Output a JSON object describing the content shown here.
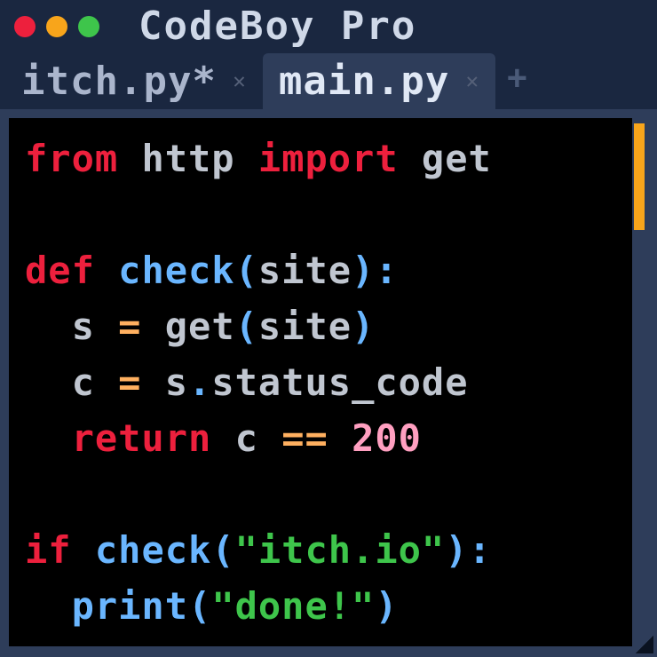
{
  "window": {
    "title": "CodeBoy Pro"
  },
  "tabs": [
    {
      "label": "itch.py*",
      "active": false
    },
    {
      "label": "main.py",
      "active": true
    }
  ],
  "code": {
    "lines": [
      [
        {
          "cls": "tok-kw",
          "t": "from"
        },
        {
          "cls": "",
          "t": " "
        },
        {
          "cls": "tok-id",
          "t": "http"
        },
        {
          "cls": "",
          "t": " "
        },
        {
          "cls": "tok-kw",
          "t": "import"
        },
        {
          "cls": "",
          "t": " "
        },
        {
          "cls": "tok-id",
          "t": "get"
        }
      ],
      [],
      [
        {
          "cls": "tok-kw",
          "t": "def"
        },
        {
          "cls": "",
          "t": " "
        },
        {
          "cls": "tok-fn",
          "t": "check"
        },
        {
          "cls": "tok-punc",
          "t": "("
        },
        {
          "cls": "tok-id",
          "t": "site"
        },
        {
          "cls": "tok-punc",
          "t": ")"
        },
        {
          "cls": "tok-punc",
          "t": ":"
        }
      ],
      [
        {
          "cls": "",
          "t": "  "
        },
        {
          "cls": "tok-id",
          "t": "s"
        },
        {
          "cls": "",
          "t": " "
        },
        {
          "cls": "tok-op",
          "t": "="
        },
        {
          "cls": "",
          "t": " "
        },
        {
          "cls": "tok-id",
          "t": "get"
        },
        {
          "cls": "tok-punc",
          "t": "("
        },
        {
          "cls": "tok-id",
          "t": "site"
        },
        {
          "cls": "tok-punc",
          "t": ")"
        }
      ],
      [
        {
          "cls": "",
          "t": "  "
        },
        {
          "cls": "tok-id",
          "t": "c"
        },
        {
          "cls": "",
          "t": " "
        },
        {
          "cls": "tok-op",
          "t": "="
        },
        {
          "cls": "",
          "t": " "
        },
        {
          "cls": "tok-id",
          "t": "s"
        },
        {
          "cls": "tok-punc",
          "t": "."
        },
        {
          "cls": "tok-id",
          "t": "status_code"
        }
      ],
      [
        {
          "cls": "",
          "t": "  "
        },
        {
          "cls": "tok-kw",
          "t": "return"
        },
        {
          "cls": "",
          "t": " "
        },
        {
          "cls": "tok-id",
          "t": "c"
        },
        {
          "cls": "",
          "t": " "
        },
        {
          "cls": "tok-op",
          "t": "=="
        },
        {
          "cls": "",
          "t": " "
        },
        {
          "cls": "tok-num",
          "t": "200"
        }
      ],
      [],
      [
        {
          "cls": "tok-kw",
          "t": "if"
        },
        {
          "cls": "",
          "t": " "
        },
        {
          "cls": "tok-fn",
          "t": "check"
        },
        {
          "cls": "tok-punc",
          "t": "("
        },
        {
          "cls": "tok-str",
          "t": "\"itch.io\""
        },
        {
          "cls": "tok-punc",
          "t": ")"
        },
        {
          "cls": "tok-punc",
          "t": ":"
        }
      ],
      [
        {
          "cls": "",
          "t": "  "
        },
        {
          "cls": "tok-builtin",
          "t": "print"
        },
        {
          "cls": "tok-punc",
          "t": "("
        },
        {
          "cls": "tok-str",
          "t": "\"done!\""
        },
        {
          "cls": "tok-punc",
          "t": ")"
        }
      ]
    ]
  },
  "colors": {
    "bg": "#1a2740",
    "editor_bg": "#000000",
    "active_tab": "#2e3d5a",
    "keyword": "#ed203d",
    "identifier": "#c0c6d0",
    "function": "#6ab6ff",
    "operator": "#ffb060",
    "number": "#ff9fc0",
    "string": "#3ec54b",
    "scrollbar": "#f8a51b"
  }
}
